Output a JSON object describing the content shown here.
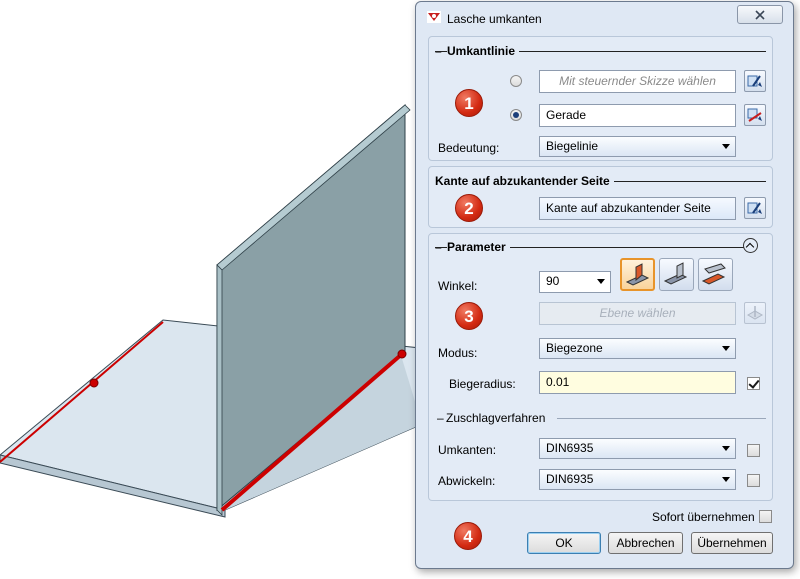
{
  "dialog": {
    "title": "Lasche umkanten"
  },
  "umkantlinie": {
    "header": "Umkantlinie",
    "badge": "1",
    "option_sketch_placeholder": "Mit steuernder Skizze wählen",
    "option_line_value": "Gerade",
    "meaning_label": "Bedeutung:",
    "meaning_value": "Biegelinie",
    "selected_option": "Gerade"
  },
  "kante": {
    "header": "Kante auf abzukantender Seite",
    "badge": "2",
    "field_value": "Kante auf abzukantender Seite"
  },
  "parameter": {
    "header": "Parameter",
    "badge": "3",
    "angle_label": "Winkel:",
    "angle_value": "90",
    "plane_placeholder": "Ebene wählen",
    "mode_label": "Modus:",
    "mode_value": "Biegezone",
    "radius_label": "Biegeradius:",
    "radius_value": "0.01",
    "radius_checked": true,
    "allowance_group": "Zuschlagverfahren",
    "bend_label": "Umkanten:",
    "bend_value": "DIN6935",
    "unfold_label": "Abwickeln:",
    "unfold_value": "DIN6935"
  },
  "footer": {
    "badge": "4",
    "apply_immediately_label": "Sofort übernehmen",
    "ok_label": "OK",
    "cancel_label": "Abbrechen",
    "apply_label": "Übernehmen"
  },
  "colors": {
    "dialog_bg": "#dfe8f4",
    "badge_red": "#d32a12",
    "bend_line_red": "#cc0000",
    "flange_fill": "#8aa0a6",
    "plate_fill": "#dbe6ef"
  }
}
